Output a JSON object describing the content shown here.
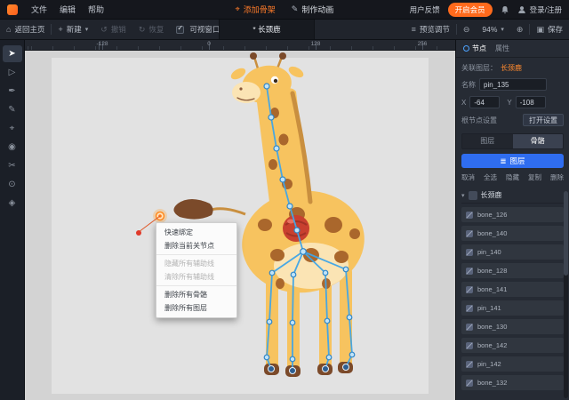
{
  "icons": {
    "bone": "⌖",
    "pen": "✎",
    "home": "⌂",
    "plus": "+",
    "undo": "↺",
    "redo": "↻",
    "caret": "▾",
    "zoom_out": "⊖",
    "zoom_in": "⊕",
    "preview": "≡",
    "save": "▣",
    "layers": "≣",
    "tree_caret": "▾"
  },
  "menubar": {
    "menus": [
      {
        "name": "menu-file",
        "label": "文件"
      },
      {
        "name": "menu-edit",
        "label": "编辑"
      },
      {
        "name": "menu-help",
        "label": "帮助"
      }
    ],
    "mode_add_skeleton": "添加骨架",
    "mode_make_animation": "制作动画",
    "user_feedback": "用户反馈",
    "vip": "开启会员",
    "login": "登录/注册"
  },
  "toolbar": {
    "back_home": "返回主页",
    "new": "新建",
    "undo": "撤销",
    "redo": "恢复",
    "visible_window": "可视窗口",
    "tab": "* 长颈鹿",
    "preview": "预览调节",
    "zoom": "94%",
    "save": "保存"
  },
  "ruler": {
    "labels": [
      {
        "text": "-128",
        "pos": 87
      },
      {
        "text": "0",
        "pos": 207
      },
      {
        "text": "128",
        "pos": 327
      },
      {
        "text": "256",
        "pos": 447
      }
    ]
  },
  "tools": [
    {
      "name": "tool-select",
      "glyph": "➤",
      "active": true
    },
    {
      "name": "tool-direct-select",
      "glyph": "▷"
    },
    {
      "name": "tool-pen",
      "glyph": "✒"
    },
    {
      "name": "tool-pencil",
      "glyph": "✎"
    },
    {
      "name": "tool-bone",
      "glyph": "⌖"
    },
    {
      "name": "tool-pin",
      "glyph": "◉"
    },
    {
      "name": "tool-cut",
      "glyph": "✂"
    },
    {
      "name": "tool-zoom",
      "glyph": "⊙"
    },
    {
      "name": "tool-hand",
      "glyph": "◈"
    }
  ],
  "context_menu": {
    "items": [
      {
        "name": "ctx-quick-bind",
        "label": "快速绑定"
      },
      {
        "name": "ctx-delete-current-joint",
        "label": "删除当前关节点"
      },
      {
        "name": "ctx-hide-all-guides",
        "label": "隐藏所有辅助线",
        "disabled": true,
        "sep": true
      },
      {
        "name": "ctx-clear-all-guides",
        "label": "清除所有辅助线",
        "disabled": true
      },
      {
        "name": "ctx-delete-all-bones",
        "label": "删除所有骨骼",
        "sep": true
      },
      {
        "name": "ctx-delete-all-layers",
        "label": "删除所有图层"
      }
    ]
  },
  "panel": {
    "tab_node": "节点",
    "tab_props": "属性",
    "linked_layer_label": "关联图层：",
    "linked_layer": "长颈鹿",
    "name_label": "名称",
    "name_value": "pin_135",
    "x_label": "X",
    "x_value": "-64",
    "y_label": "Y",
    "y_value": "-108",
    "root_label": "根节点设置",
    "root_button": "打开设置",
    "tab_layer": "图层",
    "tab_bone": "骨骼",
    "layer_button": "图层",
    "ops": [
      {
        "name": "op-cancel",
        "label": "取消"
      },
      {
        "name": "op-select-all",
        "label": "全选"
      },
      {
        "name": "op-hide",
        "label": "隐藏"
      },
      {
        "name": "op-copy",
        "label": "复制"
      },
      {
        "name": "op-delete",
        "label": "删除"
      }
    ],
    "tree_root": "长颈鹿",
    "bones": [
      "bone_126",
      "bone_140",
      "pin_140",
      "bone_128",
      "bone_141",
      "pin_141",
      "bone_130",
      "bone_142",
      "pin_142",
      "bone_132"
    ]
  },
  "colors": {
    "accent_orange": "#ff7b29",
    "vip_orange": "#ff6a1c",
    "accent_blue": "#2f6df0",
    "skeleton_blue": "#3fa5e8",
    "canvas_gray": "#d3d3d3"
  }
}
